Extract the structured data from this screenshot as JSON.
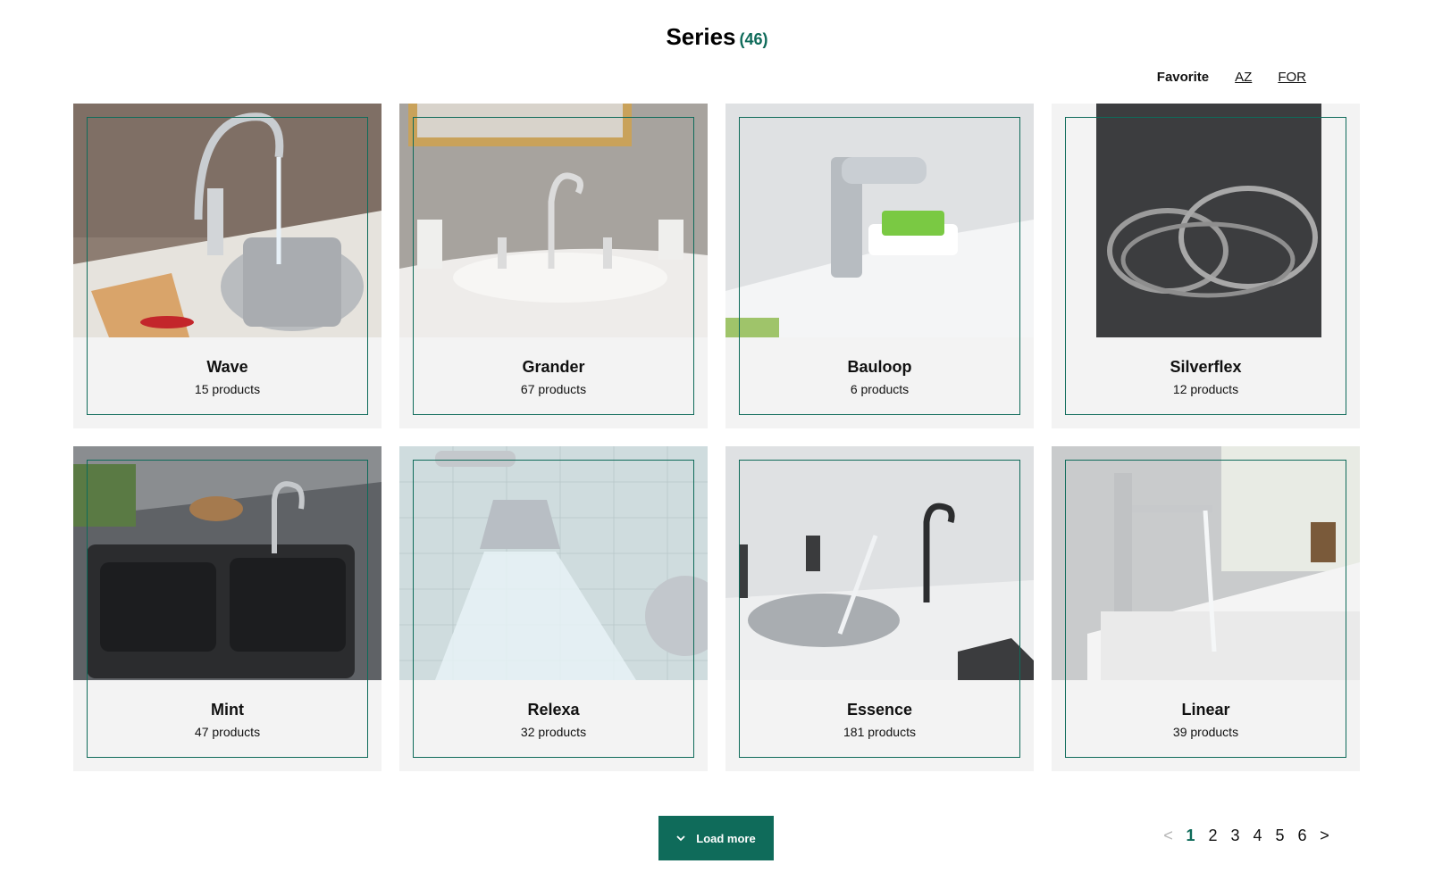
{
  "header": {
    "title": "Series",
    "count": "(46)"
  },
  "sort": {
    "favorite": "Favorite",
    "az": "AZ",
    "for": "FOR"
  },
  "cards": [
    {
      "name": "Wave",
      "products": "15 products"
    },
    {
      "name": "Grander",
      "products": "67 products"
    },
    {
      "name": "Bauloop",
      "products": "6 products"
    },
    {
      "name": "Silverflex",
      "products": "12 products"
    },
    {
      "name": "Mint",
      "products": "47 products"
    },
    {
      "name": "Relexa",
      "products": "32 products"
    },
    {
      "name": "Essence",
      "products": "181 products"
    },
    {
      "name": "Linear",
      "products": "39 products"
    }
  ],
  "load_more": {
    "label": "Load more",
    "icon": "chevron-down-icon"
  },
  "pager": {
    "prev": "<",
    "pages": [
      "1",
      "2",
      "3",
      "4",
      "5",
      "6"
    ],
    "next": ">",
    "current": "1"
  },
  "colors": {
    "accent": "#0f6b5a",
    "card_bg": "#f3f3f3"
  }
}
